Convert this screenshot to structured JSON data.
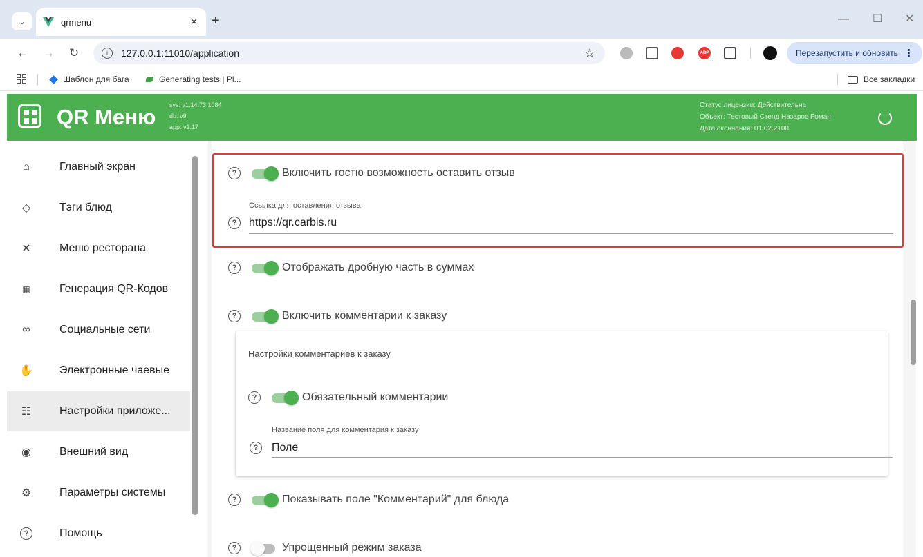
{
  "browser": {
    "tab_title": "qrmenu",
    "new_tab": "+",
    "url": "127.0.0.1:11010/application",
    "relaunch_label": "Перезапустить и обновить",
    "bookmarks": [
      "Шаблон для бага",
      "Generating tests | Pl..."
    ],
    "all_bookmarks": "Все закладки"
  },
  "header": {
    "title": "QR Меню",
    "versions": [
      "sys: v1.14.73.1084",
      "db: v9",
      "app: v1.17"
    ],
    "license_lines": [
      "Статус лицензии: Действительна",
      "Объект: Тестовый Стенд Назаров Роман",
      "Дата окончания: 01.02.2100"
    ],
    "accent": "#4caf50"
  },
  "sidebar": {
    "items": [
      {
        "label": "Главный экран",
        "icon": "home-icon"
      },
      {
        "label": "Тэги блюд",
        "icon": "tag-icon"
      },
      {
        "label": "Меню ресторана",
        "icon": "cutlery-icon"
      },
      {
        "label": "Генерация QR-Кодов",
        "icon": "qr-icon"
      },
      {
        "label": "Социальные сети",
        "icon": "link-icon"
      },
      {
        "label": "Электронные чаевые",
        "icon": "tip-hand-icon"
      },
      {
        "label": "Настройки приложе...",
        "icon": "app-settings-icon",
        "active": true
      },
      {
        "label": "Внешний вид",
        "icon": "eye-icon"
      },
      {
        "label": "Параметры системы",
        "icon": "gear-icon"
      },
      {
        "label": "Помощь",
        "icon": "help-icon"
      }
    ]
  },
  "settings": {
    "review_toggle": "Включить гостю возможность оставить отзыв",
    "review_link_caption": "Ссылка для оставления отзыва",
    "review_link_value": "https://qr.carbis.ru",
    "fraction_toggle": "Отображать дробную часть в суммах",
    "comments_toggle": "Включить комментарии к заказу",
    "comments_panel_title": "Настройки комментариев к заказу",
    "required_comment_toggle": "Обязательный комментарии",
    "comment_field_caption": "Название поля для комментария к заказу",
    "comment_field_value": "Поле",
    "dish_comment_toggle": "Показывать поле \"Комментарий\" для блюда",
    "simple_mode_toggle": "Упрощенный режим заказа"
  }
}
